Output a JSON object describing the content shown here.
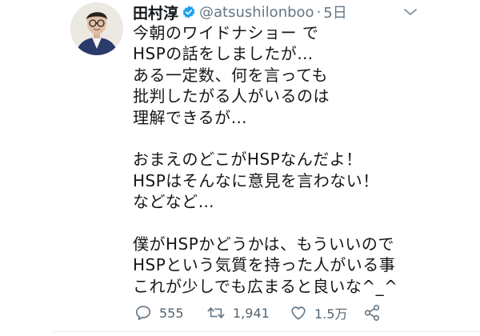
{
  "tweet": {
    "author_name": "田村淳",
    "handle": "@atsushilonboo",
    "separator": "·",
    "time": "5日",
    "lines": [
      "今朝のワイドナショー で",
      "HSPの話をしましたが…",
      "ある一定数、何を言っても",
      "批判したがる人がいるのは",
      "理解できるが…",
      "",
      "おまえのどこがHSPなんだよ！",
      "HSPはそんなに意見を言わない！",
      "などなど…",
      "",
      "僕がHSPかどうかは、もういいので",
      "HSPという気質を持った人がいる事",
      "これが少しでも広まると良いな^_^"
    ],
    "replies": "555",
    "retweets": "1,941",
    "likes": "1.5万"
  },
  "colors": {
    "verified": "#1da1f2",
    "muted": "#657786",
    "text": "#14171a"
  },
  "icons": {
    "verified": "verified-badge-icon",
    "caret": "chevron-down-icon",
    "reply": "reply-icon",
    "retweet": "retweet-icon",
    "like": "heart-icon",
    "share": "share-icon"
  }
}
